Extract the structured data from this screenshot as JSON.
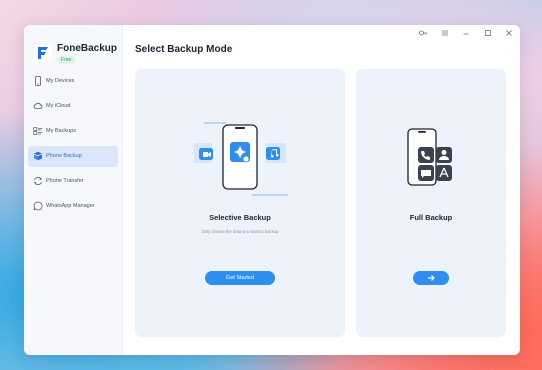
{
  "app": {
    "name": "FoneBackup",
    "badge": "Free"
  },
  "sidebar": {
    "items": [
      {
        "label": "My Devices",
        "icon": "phone-icon",
        "active": false
      },
      {
        "label": "My iCloud",
        "icon": "cloud-icon",
        "active": false
      },
      {
        "label": "My Backups",
        "icon": "backups-list-icon",
        "active": false
      },
      {
        "label": "Phone Backup",
        "icon": "phone-backup-icon",
        "active": true
      },
      {
        "label": "Phone Transfer",
        "icon": "transfer-icon",
        "active": false
      },
      {
        "label": "WhatsApp Manager",
        "icon": "whatsapp-icon",
        "active": false
      }
    ]
  },
  "window_controls": [
    "key-icon",
    "menu-icon",
    "minimize-icon",
    "maximize-icon",
    "close-icon"
  ],
  "main": {
    "title": "Select Backup Mode",
    "selective": {
      "title": "Selective Backup",
      "description": "Only choose the data you want to backup",
      "button_label": "Get Started"
    },
    "full": {
      "title": "Full Backup",
      "button_icon": "arrow-right-icon"
    }
  },
  "colors": {
    "accent": "#2f8ff0",
    "active_nav_bg": "#dbe6fb",
    "card_bg": "#edf2fb"
  }
}
